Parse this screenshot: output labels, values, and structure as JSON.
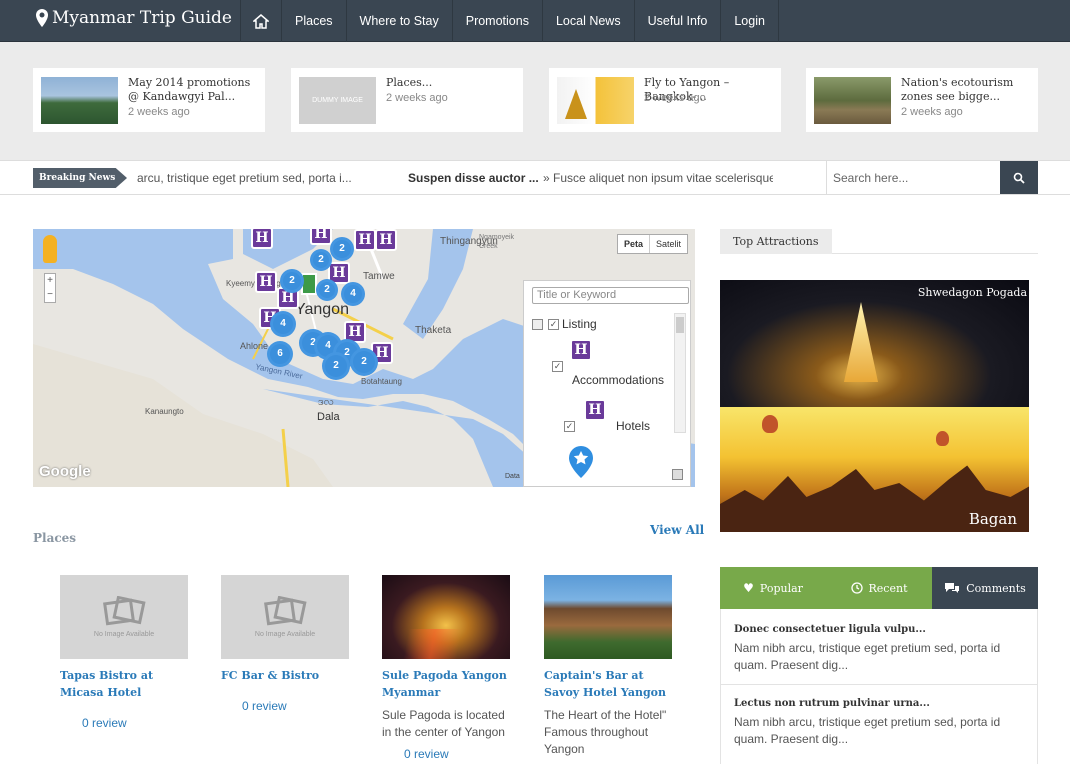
{
  "brand": {
    "title": "Myanmar Trip Guide"
  },
  "nav": {
    "items": [
      "Places",
      "Where to Stay",
      "Promotions",
      "Local News",
      "Useful Info",
      "Login"
    ]
  },
  "featured": [
    {
      "title": "May 2014 promotions @ Kandawgyi Pal...",
      "date": "2 weeks ago"
    },
    {
      "title": "Places...",
      "date": "2 weeks ago",
      "thumb_text": "DUMMY IMAGE"
    },
    {
      "title": "Fly to Yangon – Bangkok-...",
      "date": "2 weeks ago"
    },
    {
      "title": "Nation's ecotourism zones see bigge...",
      "date": "2 weeks ago"
    }
  ],
  "breaking": {
    "label": "Breaking News",
    "item1": "arcu, tristique eget pretium sed, porta i...",
    "item2": "Suspen disse auctor ...",
    "item3": "» Fusce aliquet non ipsum vitae scelerisque. I"
  },
  "search": {
    "placeholder": "Search here..."
  },
  "map": {
    "type_buttons": [
      "Peta",
      "Satelit"
    ],
    "filter_placeholder": "Title or Keyword",
    "listing_label": "Listing",
    "categories": [
      "Accommodations",
      "Hotels"
    ],
    "labels": {
      "thingangyun": "Thingangyun",
      "tamwe": "Tamwe",
      "kyeemyindaing": "Kyeemyindaing",
      "yangon": "Yangon",
      "thaketa": "Thaketa",
      "ahlone": "Ahlone",
      "botahtaung": "Botahtaung",
      "yangon_river": "Yangon River",
      "kanaungto": "Kanaungto",
      "dala": "Dala",
      "dala_mm": "ဒလ",
      "ngamoyeik": "Ngamoyeik Creek"
    },
    "attribution": "Google",
    "attribution2": "Data",
    "clusters": [
      "2",
      "2",
      "2",
      "4",
      "4",
      "2",
      "2",
      "6",
      "4",
      "2",
      "2",
      "2"
    ]
  },
  "places": {
    "heading": "Places",
    "view_all": "View All",
    "items": [
      {
        "title": "Tapas Bistro at Micasa Hotel",
        "desc": "",
        "review": "0 review",
        "no_image": "No Image Available"
      },
      {
        "title": "FC Bar & Bistro",
        "desc": "",
        "review": "0 review",
        "no_image": "No Image Available"
      },
      {
        "title": "Sule Pagoda Yangon Myanmar",
        "desc": "Sule Pagoda is located in the center of Yangon",
        "review": "0 review"
      },
      {
        "title": "Captain's Bar at Savoy Hotel Yangon",
        "desc": "The Heart of the Hotel\" Famous throughout Yangon",
        "review": ""
      }
    ]
  },
  "sidebar": {
    "attractions_title": "Top Attractions",
    "att1": "Shwedagon Pogada",
    "att2": "Bagan",
    "tabs": [
      "Popular",
      "Recent",
      "Comments"
    ],
    "posts": [
      {
        "title": "Donec consectetuer ligula vulpu...",
        "body": "Nam nibh arcu, tristique eget pretium sed, porta id quam. Praesent dig..."
      },
      {
        "title": "Lectus non rutrum pulvinar urna...",
        "body": "Nam nibh arcu, tristique eget pretium sed, porta id quam. Praesent dig..."
      }
    ]
  },
  "colors": {
    "nav": "#3a4652",
    "accent": "#2a7ab8",
    "tab_green": "#78a94a",
    "pin": "#6a3a9a",
    "cluster": "#3b8fdc"
  }
}
